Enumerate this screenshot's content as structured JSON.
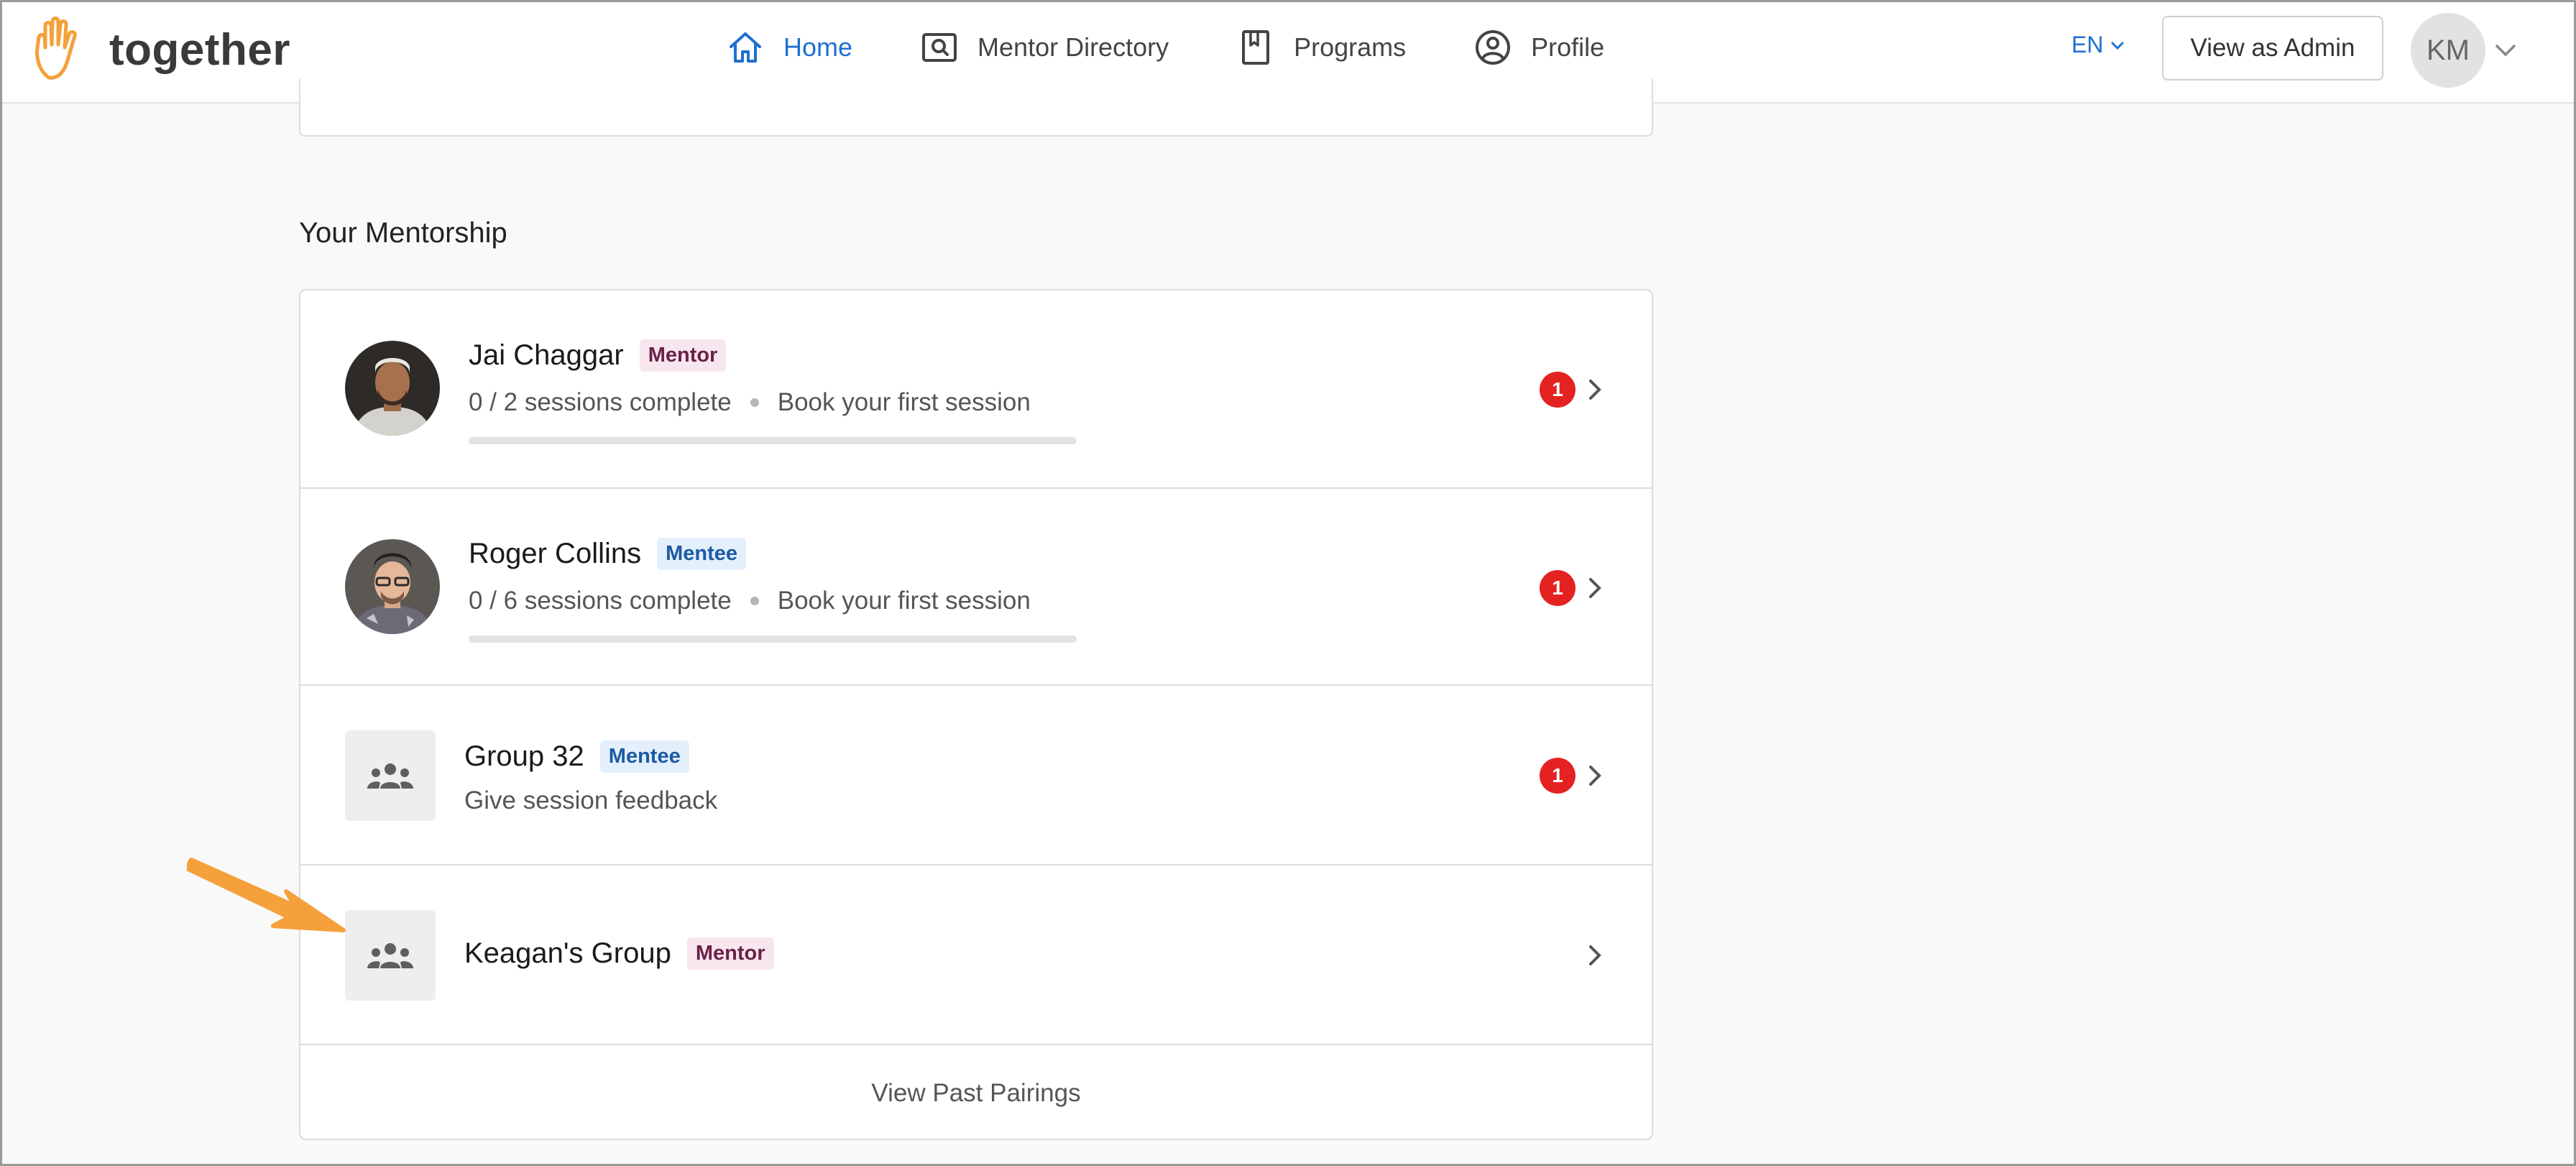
{
  "brand": {
    "name": "together",
    "accent": "#f5a03a"
  },
  "nav": {
    "items": [
      {
        "label": "Home",
        "icon": "home-icon",
        "active": true
      },
      {
        "label": "Mentor Directory",
        "icon": "directory-icon",
        "active": false
      },
      {
        "label": "Programs",
        "icon": "book-icon",
        "active": false
      },
      {
        "label": "Profile",
        "icon": "user-circle-icon",
        "active": false
      }
    ],
    "active_color": "#1f6fd0"
  },
  "header": {
    "language": "EN",
    "admin_button": "View as Admin",
    "user_initials": "KM"
  },
  "section": {
    "title": "Your Mentorship"
  },
  "pairings": [
    {
      "name": "Jai Chaggar",
      "role": "Mentor",
      "sessions": "0 / 2 sessions complete",
      "action": "Book your first session",
      "progress": 0,
      "notifications": "1"
    },
    {
      "name": "Roger Collins",
      "role": "Mentee",
      "sessions": "0 / 6 sessions complete",
      "action": "Book your first session",
      "progress": 0,
      "notifications": "1"
    },
    {
      "name": "Group 32",
      "role": "Mentee",
      "subtitle": "Give session feedback",
      "notifications": "1"
    },
    {
      "name": "Keagan's Group",
      "role": "Mentor"
    }
  ],
  "footer_link": "View Past Pairings",
  "colors": {
    "mentor_badge": "#6b2247",
    "mentee_badge": "#1c5aa3",
    "notification": "#e42222",
    "annotation_arrow": "#f5a03a"
  }
}
